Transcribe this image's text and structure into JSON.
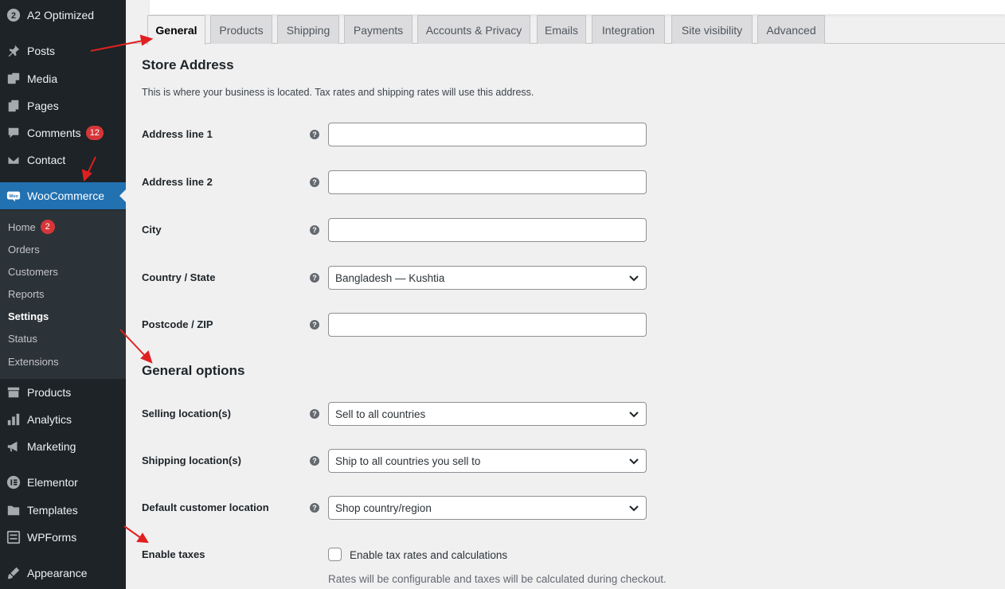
{
  "sidebar": {
    "top_item": "A2 Optimized",
    "items": [
      {
        "key": "posts",
        "label": "Posts",
        "icon": "pin-icon"
      },
      {
        "key": "media",
        "label": "Media",
        "icon": "media-icon"
      },
      {
        "key": "pages",
        "label": "Pages",
        "icon": "pages-icon"
      },
      {
        "key": "comments",
        "label": "Comments",
        "icon": "comment-icon",
        "badge": "12"
      },
      {
        "key": "contact",
        "label": "Contact",
        "icon": "mail-icon"
      },
      {
        "key": "woocommerce",
        "label": "WooCommerce",
        "icon": "woo-icon"
      },
      {
        "key": "products",
        "label": "Products",
        "icon": "archive-icon"
      },
      {
        "key": "analytics",
        "label": "Analytics",
        "icon": "bar-chart-icon"
      },
      {
        "key": "marketing",
        "label": "Marketing",
        "icon": "megaphone-icon"
      },
      {
        "key": "elementor",
        "label": "Elementor",
        "icon": "elementor-icon"
      },
      {
        "key": "templates",
        "label": "Templates",
        "icon": "folder-icon"
      },
      {
        "key": "wpforms",
        "label": "WPForms",
        "icon": "forms-icon"
      },
      {
        "key": "appearance",
        "label": "Appearance",
        "icon": "brush-icon"
      }
    ],
    "submenu": {
      "home": "Home",
      "home_badge": "2",
      "orders": "Orders",
      "customers": "Customers",
      "reports": "Reports",
      "settings": "Settings",
      "status": "Status",
      "extensions": "Extensions"
    }
  },
  "tabs": [
    "General",
    "Products",
    "Shipping",
    "Payments",
    "Accounts & Privacy",
    "Emails",
    "Integration",
    "Site visibility",
    "Advanced"
  ],
  "active_tab": "General",
  "store_address": {
    "title": "Store Address",
    "description": "This is where your business is located. Tax rates and shipping rates will use this address.",
    "address1_label": "Address line 1",
    "address1_value": "",
    "address2_label": "Address line 2",
    "address2_value": "",
    "city_label": "City",
    "city_value": "",
    "country_label": "Country / State",
    "country_value": "Bangladesh — Kushtia",
    "postcode_label": "Postcode / ZIP",
    "postcode_value": ""
  },
  "general_options": {
    "title": "General options",
    "selling_label": "Selling location(s)",
    "selling_value": "Sell to all countries",
    "shipping_label": "Shipping location(s)",
    "shipping_value": "Ship to all countries you sell to",
    "default_label": "Default customer location",
    "default_value": "Shop country/region",
    "taxes_label": "Enable taxes",
    "taxes_checkbox_label": "Enable tax rates and calculations",
    "taxes_checked": false,
    "taxes_desc": "Rates will be configurable and taxes will be calculated during checkout."
  },
  "help_glyph": "?",
  "colors": {
    "sidebar_bg": "#1d2327",
    "submenu_bg": "#2c3338",
    "accent": "#2271b1",
    "badge": "#d63638",
    "annotation_arrow": "#e02020"
  }
}
